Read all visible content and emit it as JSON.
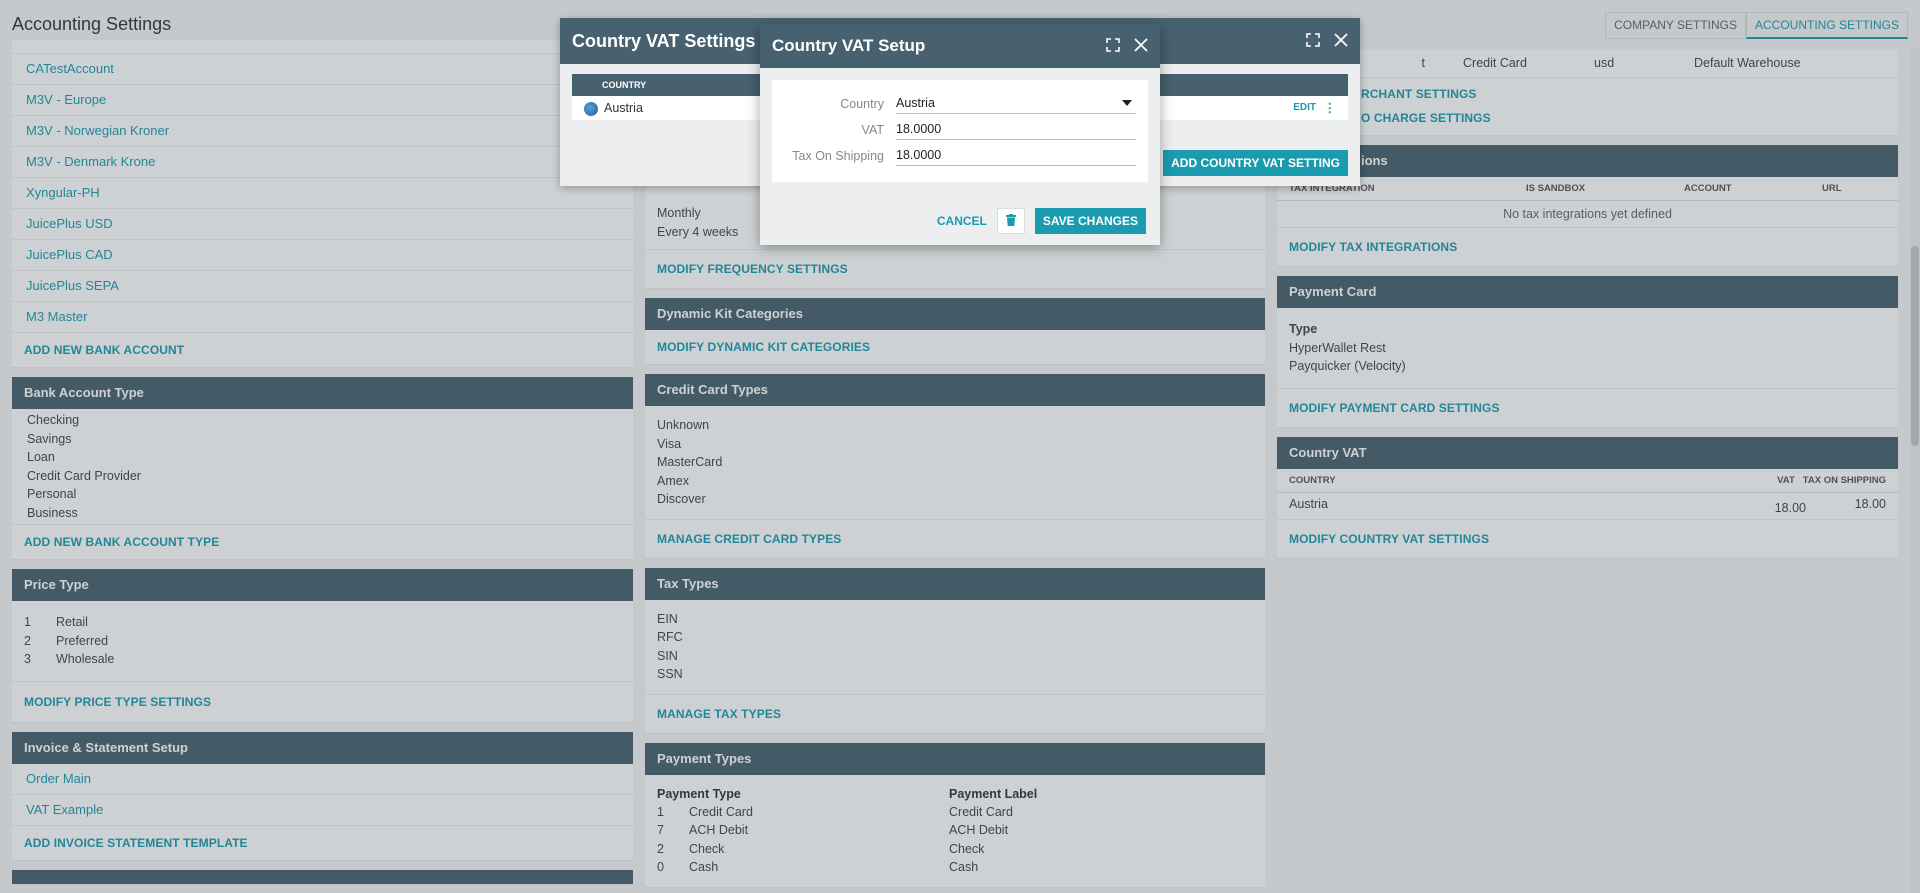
{
  "header": {
    "title": "Accounting Settings",
    "tabs": [
      {
        "label": "COMPANY SETTINGS",
        "active": false
      },
      {
        "label": "ACCOUNTING SETTINGS",
        "active": true
      }
    ]
  },
  "left": {
    "bank_accounts": {
      "items": [
        "CATestAccount",
        "M3V - Europe",
        "M3V - Norwegian Kroner",
        "M3V - Denmark Krone",
        "Xyngular-PH",
        "JuicePlus USD",
        "JuicePlus CAD",
        "JuicePlus SEPA",
        "M3 Master"
      ],
      "action": "ADD NEW BANK ACCOUNT"
    },
    "bank_account_type": {
      "title": "Bank Account Type",
      "items": [
        "Checking",
        "Savings",
        "Loan",
        "Credit Card Provider",
        "Personal",
        "Business"
      ],
      "action": "ADD NEW BANK ACCOUNT TYPE"
    },
    "price_type": {
      "title": "Price Type",
      "rows": [
        {
          "n": "1",
          "label": "Retail"
        },
        {
          "n": "2",
          "label": "Preferred"
        },
        {
          "n": "3",
          "label": "Wholesale"
        }
      ],
      "action": "MODIFY PRICE TYPE SETTINGS"
    },
    "invoice": {
      "title": "Invoice & Statement Setup",
      "items": [
        "Order Main",
        "VAT Example"
      ],
      "action": "ADD INVOICE STATEMENT TEMPLATE"
    }
  },
  "middle": {
    "frequency": {
      "items": [
        "Monthly",
        "Every 4 weeks"
      ],
      "action": "MODIFY FREQUENCY SETTINGS"
    },
    "dynamic_kit": {
      "title": "Dynamic Kit Categories",
      "action": "MODIFY DYNAMIC KIT CATEGORIES"
    },
    "credit_card_types": {
      "title": "Credit Card Types",
      "items": [
        "Unknown",
        "Visa",
        "MasterCard",
        "Amex",
        "Discover"
      ],
      "action": "MANAGE CREDIT CARD TYPES"
    },
    "tax_types": {
      "title": "Tax Types",
      "items": [
        "EIN",
        "RFC",
        "SIN",
        "SSN"
      ],
      "action": "MANAGE TAX TYPES"
    },
    "payment_types": {
      "title": "Payment Types",
      "col1": "Payment Type",
      "col2": "Payment Label",
      "rows": [
        {
          "n": "1",
          "type": "Credit Card",
          "label": "Credit Card"
        },
        {
          "n": "7",
          "type": "ACH Debit",
          "label": "ACH Debit"
        },
        {
          "n": "2",
          "type": "Check",
          "label": "Check"
        },
        {
          "n": "0",
          "type": "Cash",
          "label": "Cash"
        }
      ]
    }
  },
  "right": {
    "merchant": {
      "row": {
        "c1": "t",
        "c2": "Credit Card",
        "c3": "usd",
        "c4": "Default Warehouse"
      },
      "actions": [
        "RCHANT SETTINGS",
        "O CHARGE SETTINGS"
      ]
    },
    "tax_integrations": {
      "title": "ions",
      "cols": [
        "TAX INTEGRATION",
        "IS SANDBOX",
        "ACCOUNT",
        "URL"
      ],
      "empty": "No tax integrations yet defined",
      "action": "MODIFY TAX INTEGRATIONS"
    },
    "payment_card": {
      "title": "Payment Card",
      "type_label": "Type",
      "items": [
        "HyperWallet Rest",
        "Payquicker (Velocity)"
      ],
      "action": "MODIFY PAYMENT CARD SETTINGS"
    },
    "country_vat": {
      "title": "Country VAT",
      "cols": [
        "COUNTRY",
        "VAT",
        "TAX ON SHIPPING"
      ],
      "row": {
        "country": "Austria",
        "vat": "18.00",
        "shipping": "18.00"
      },
      "action": "MODIFY COUNTRY VAT SETTINGS"
    }
  },
  "dialog_settings": {
    "title": "Country VAT Settings",
    "col_country": "COUNTRY",
    "row_country": "Austria",
    "row_edit": "EDIT",
    "add_button": "ADD COUNTRY VAT SETTING"
  },
  "dialog_setup": {
    "title": "Country VAT Setup",
    "country_label": "Country",
    "country_value": "Austria",
    "vat_label": "VAT",
    "vat_value": "18.0000",
    "shipping_label": "Tax On Shipping",
    "shipping_value": "18.0000",
    "cancel": "CANCEL",
    "save": "SAVE CHANGES"
  }
}
